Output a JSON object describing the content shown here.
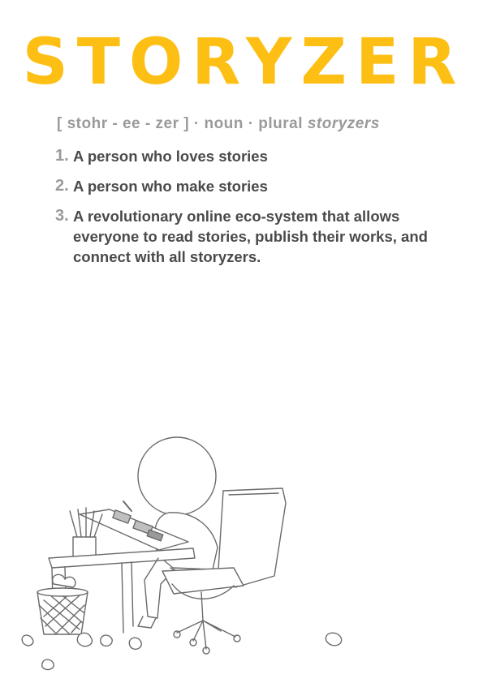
{
  "title": "STORYZER",
  "pronunciation": {
    "phonetic": "[ stohr - ee - zer ]",
    "separator1": "·",
    "part_of_speech": "noun",
    "separator2": "·",
    "plural_label": "plural",
    "plural_form": "storyzers"
  },
  "definitions": [
    {
      "num": "1.",
      "text": "A person who loves stories"
    },
    {
      "num": "2.",
      "text": "A person who make stories"
    },
    {
      "num": "3.",
      "text": "A revolutionary online eco-system that allows everyone to read stories, publish their works, and connect with all storyzers."
    }
  ],
  "colors": {
    "accent": "#fdbf13",
    "gray": "#9a9a9a",
    "text": "#4a4a4a"
  }
}
